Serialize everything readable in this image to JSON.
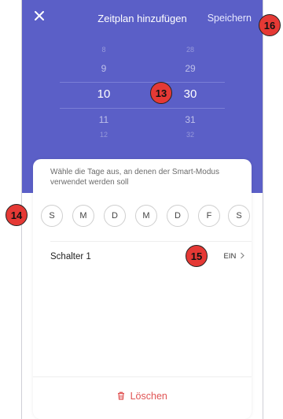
{
  "header": {
    "title": "Zeitplan hinzufügen",
    "save_label": "Speichern"
  },
  "picker": {
    "hours": [
      "8",
      "9",
      "10",
      "11",
      "12"
    ],
    "minutes": [
      "28",
      "29",
      "30",
      "31",
      "32"
    ],
    "selected_hour": "10",
    "selected_minute": "30"
  },
  "days_section": {
    "hint": "Wähle die Tage aus, an denen der Smart-Modus verwendet werden soll",
    "days": [
      "S",
      "M",
      "D",
      "M",
      "D",
      "F",
      "S"
    ]
  },
  "switch_row": {
    "label": "Schalter 1",
    "state": "EIN"
  },
  "actions": {
    "delete_label": "Löschen"
  },
  "annotations": [
    "13",
    "14",
    "15",
    "16"
  ],
  "colors": {
    "header_bg": "#5b5fc7",
    "delete": "#e05454",
    "badge": "#e53935"
  }
}
